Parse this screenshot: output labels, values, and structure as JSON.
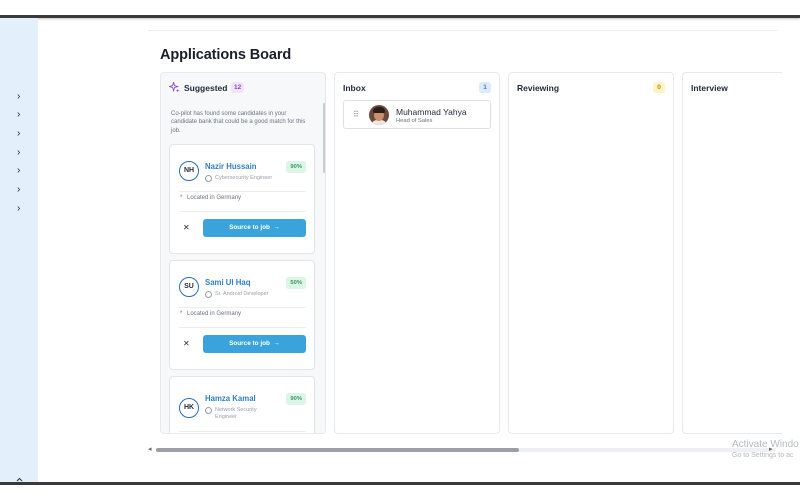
{
  "page": {
    "title": "Applications Board"
  },
  "sidebar": {
    "expand_items": [
      {
        "icon": "chevron-right-icon",
        "glyph": "›"
      },
      {
        "icon": "chevron-right-icon",
        "glyph": "›"
      },
      {
        "icon": "chevron-right-icon",
        "glyph": "›"
      },
      {
        "icon": "chevron-right-icon",
        "glyph": "›"
      },
      {
        "icon": "chevron-right-icon",
        "glyph": "›"
      },
      {
        "icon": "chevron-right-icon",
        "glyph": "›"
      },
      {
        "icon": "chevron-right-icon",
        "glyph": "›"
      }
    ],
    "bottom_toggle": {
      "icon": "chevron-up-down-icon",
      "glyph": "⌃⌄"
    }
  },
  "columns": {
    "suggested": {
      "title": "Suggested",
      "count": "12",
      "icon": "sparkle-icon",
      "description": "Co-pilot has found some candidates in your candidate bank that could be a good match for this job.",
      "accent": "#8b3fd9",
      "candidates": [
        {
          "initials": "NH",
          "name": "Nazir Hussain",
          "role": "Cybersecurity Engineer",
          "match": "90%",
          "location": "Located in Germany",
          "action": "Source to job"
        },
        {
          "initials": "SU",
          "name": "Sami Ul Haq",
          "role": "Sr. Android Developer",
          "match": "50%",
          "location": "Located in Germany",
          "action": "Source to job"
        },
        {
          "initials": "HK",
          "name": "Hamza Kamal",
          "role": "Network Security Engineer",
          "match": "90%"
        }
      ]
    },
    "inbox": {
      "title": "Inbox",
      "count": "1",
      "count_bg": "#dbeafc",
      "count_color": "#2f7fc6",
      "cards": [
        {
          "name": "Muhammad Yahya",
          "role": "Head of Sales"
        }
      ]
    },
    "reviewing": {
      "title": "Reviewing",
      "count": "0",
      "count_bg": "#fdf3c4",
      "count_color": "#b8860b"
    },
    "interview": {
      "title": "Interview"
    }
  },
  "scrollbar": {
    "position": 0.58
  },
  "watermark": {
    "title": "Activate Windo",
    "subtitle": "Go to Settings to ac"
  },
  "colors": {
    "button": "#3aa3dc",
    "match_bg": "#dcf5e6",
    "match_text": "#2e9e5d",
    "name_link": "#2f7fc6",
    "sidebar_bg": "#e3effb"
  }
}
